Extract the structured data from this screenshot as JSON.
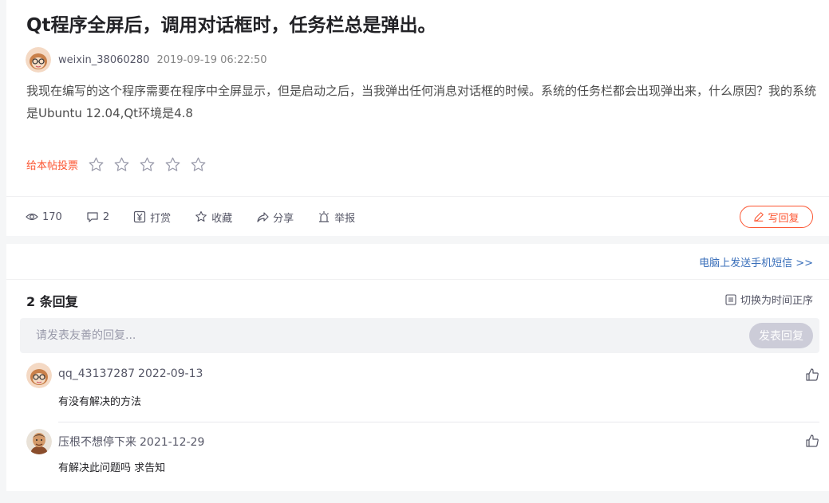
{
  "post": {
    "title": "Qt程序全屏后，调用对话框时，任务栏总是弹出。",
    "author": "weixin_38060280",
    "date": "2019-09-19 06:22:50",
    "body": "我现在编写的这个程序需要在程序中全屏显示，但是启动之后，当我弹出任何消息对话框的时候。系统的任务栏都会出现弹出来，什么原因？我的系统是Ubuntu 12.04,Qt环境是4.8",
    "vote_label": "给本帖投票",
    "stars": 5
  },
  "actions": {
    "views": "170",
    "comments": "2",
    "reward": "打赏",
    "favorite": "收藏",
    "share": "分享",
    "report": "举报",
    "write_reply": "写回复"
  },
  "replies": {
    "sms_link": "电脑上发送手机短信  >>",
    "count_label": "2 条回复",
    "sort_label": "切换为时间正序",
    "input_placeholder": "请发表友善的回复...",
    "submit_label": "发表回复",
    "items": [
      {
        "user": "qq_43137287",
        "date": "2022-09-13",
        "text": "有没有解决的方法"
      },
      {
        "user": "压根不想停下来",
        "date": "2021-12-29",
        "text": "有解决此问题吗 求告知"
      }
    ]
  },
  "colors": {
    "accent": "#fc5531",
    "link": "#3a6fba",
    "disabled": "#ccccd8"
  }
}
